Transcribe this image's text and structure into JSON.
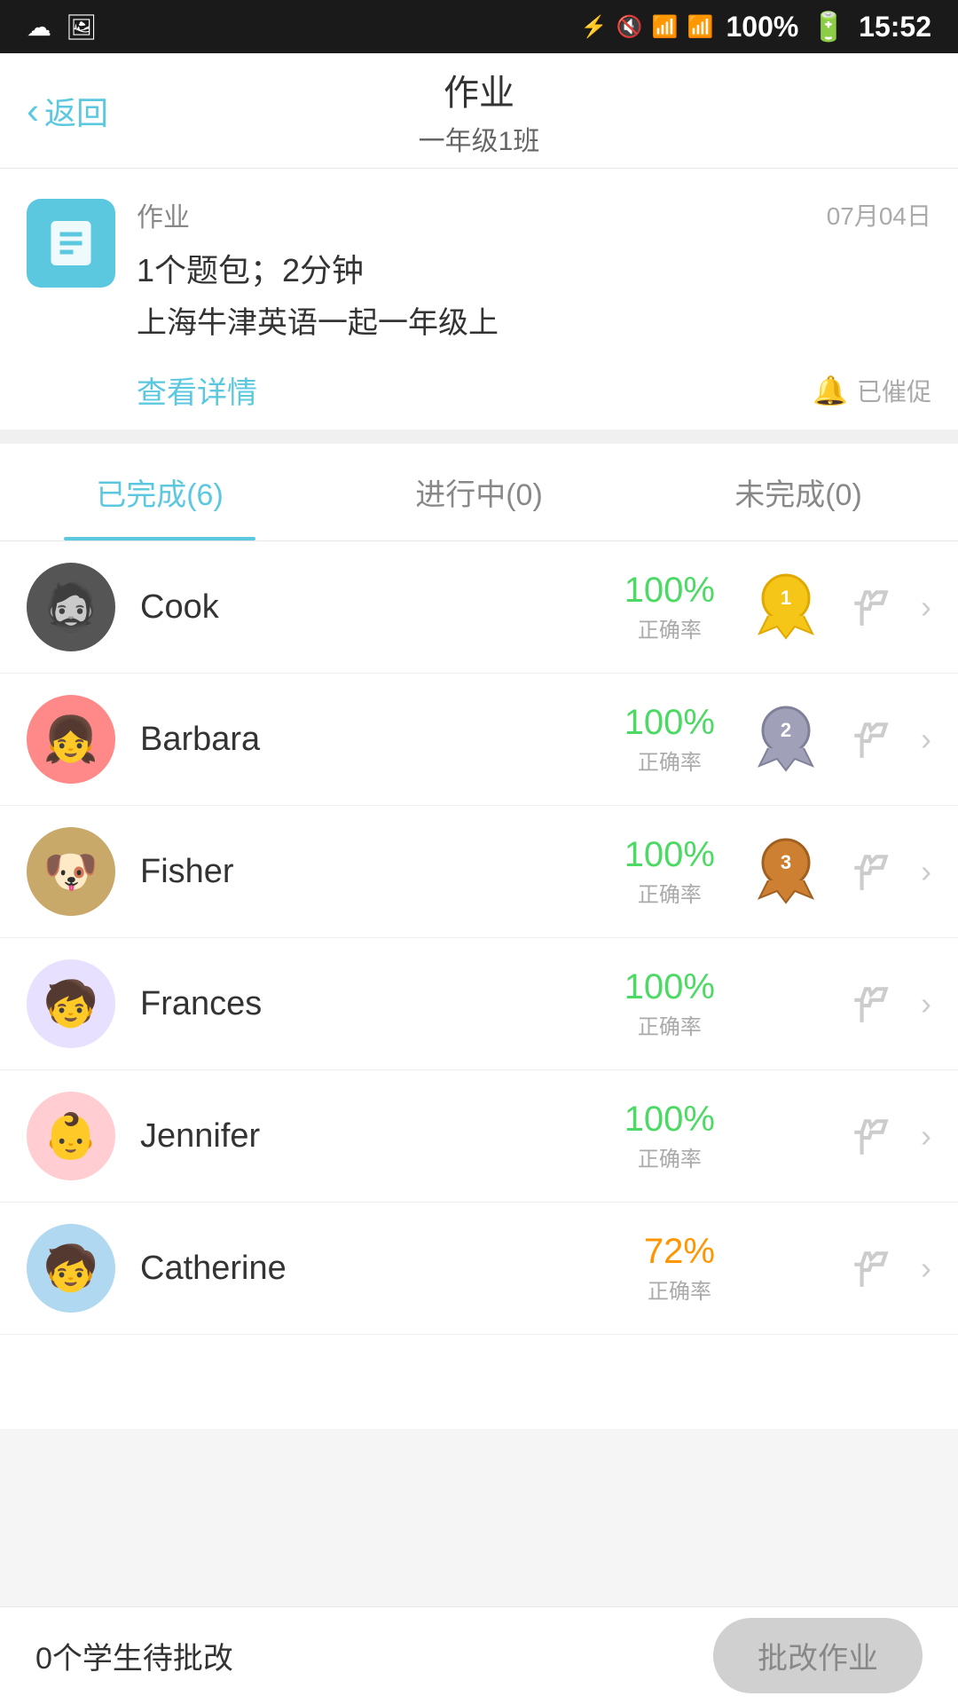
{
  "statusBar": {
    "time": "15:52",
    "battery": "100%",
    "icons": [
      "cloud",
      "image",
      "bluetooth",
      "mute",
      "wifi",
      "signal"
    ]
  },
  "header": {
    "back_label": "返回",
    "title": "作业",
    "subtitle": "一年级1班"
  },
  "homeworkCard": {
    "label": "作业",
    "date": "07月04日",
    "desc1": "1个题包；2分钟",
    "desc2": "上海牛津英语一起一年级上",
    "detail_link": "查看详情",
    "remind_label": "已催促"
  },
  "tabs": [
    {
      "id": "completed",
      "label": "已完成(6)",
      "active": true
    },
    {
      "id": "ongoing",
      "label": "进行中(0)",
      "active": false
    },
    {
      "id": "incomplete",
      "label": "未完成(0)",
      "active": false
    }
  ],
  "students": [
    {
      "id": 1,
      "name": "Cook",
      "score": "100%",
      "score_label": "正确率",
      "medal": 1,
      "is_low": false,
      "avatar_emoji": "🧔"
    },
    {
      "id": 2,
      "name": "Barbara",
      "score": "100%",
      "score_label": "正确率",
      "medal": 2,
      "is_low": false,
      "avatar_emoji": "👧"
    },
    {
      "id": 3,
      "name": "Fisher",
      "score": "100%",
      "score_label": "正确率",
      "medal": 3,
      "is_low": false,
      "avatar_emoji": "🐶"
    },
    {
      "id": 4,
      "name": "Frances",
      "score": "100%",
      "score_label": "正确率",
      "medal": 0,
      "is_low": false,
      "avatar_emoji": "🧒"
    },
    {
      "id": 5,
      "name": "Jennifer",
      "score": "100%",
      "score_label": "正确率",
      "medal": 0,
      "is_low": false,
      "avatar_emoji": "👶"
    },
    {
      "id": 6,
      "name": "Catherine",
      "score": "72%",
      "score_label": "正确率",
      "medal": 0,
      "is_low": true,
      "avatar_emoji": "🧒"
    }
  ],
  "bottomBar": {
    "pending_text": "0个学生待批改",
    "grade_btn_label": "批改作业"
  },
  "colors": {
    "accent": "#5bc8e0",
    "green": "#4cd964",
    "orange": "#ff9500",
    "gold": "#f5c518",
    "silver": "#a0a0b0",
    "bronze": "#cd7f32"
  }
}
